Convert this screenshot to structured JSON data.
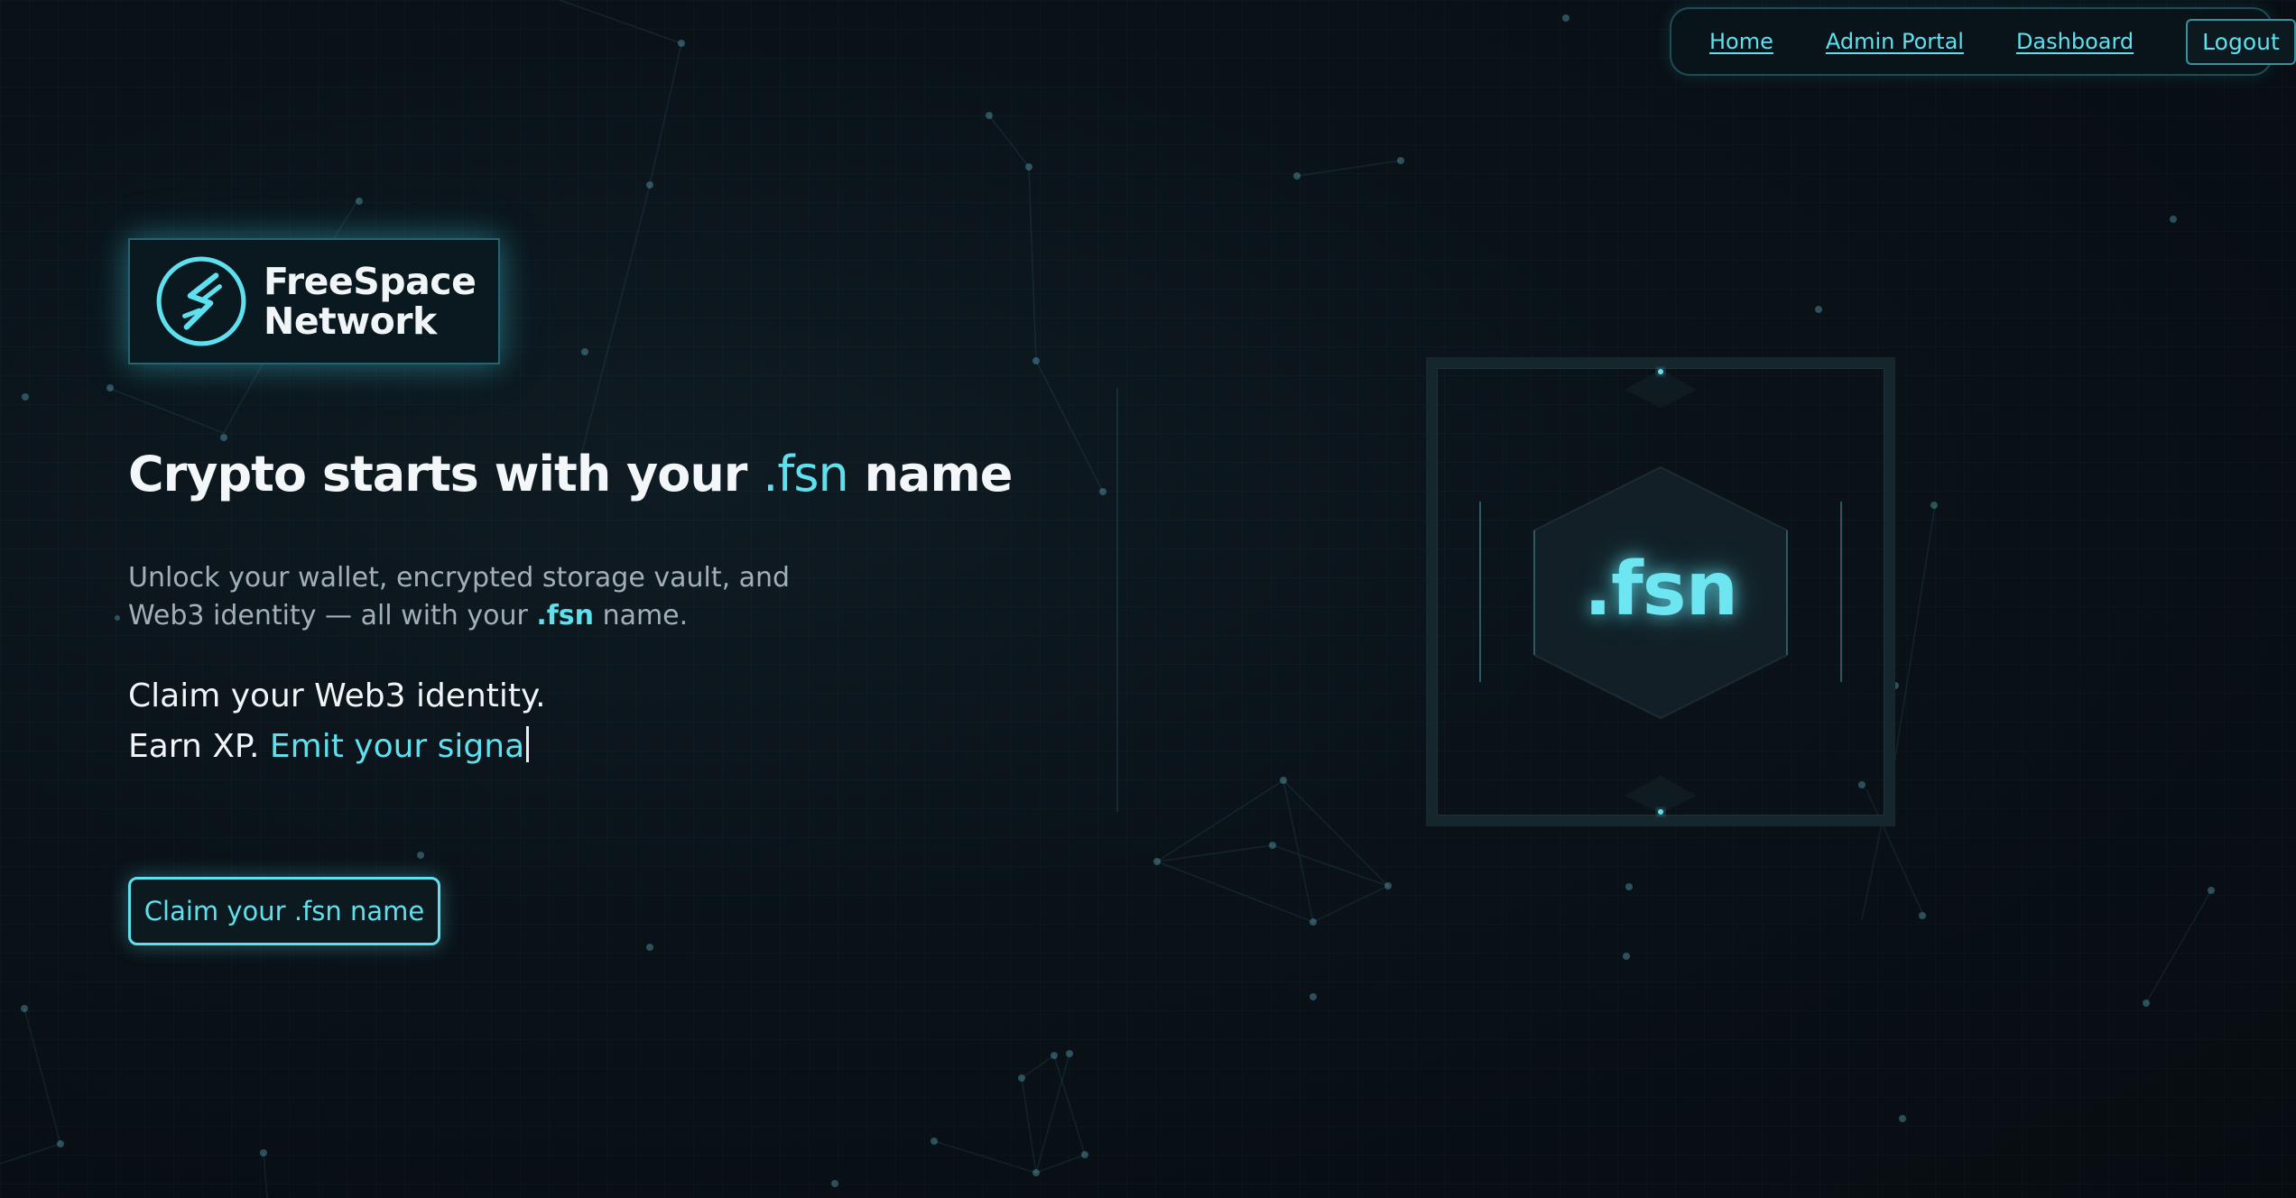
{
  "nav": {
    "home": "Home",
    "admin_portal": "Admin Portal",
    "dashboard": "Dashboard",
    "logout": "Logout"
  },
  "logo": {
    "line1": "FreeSpace",
    "line2": "Network",
    "icon": "freespace-network-logo-icon"
  },
  "hero": {
    "title_prefix": "Crypto starts with your",
    "title_accent": ".fsn",
    "title_suffix": "name",
    "subtitle_part1": "Unlock your wallet, encrypted storage vault, and Web3 identity — all with your",
    "subtitle_accent": ".fsn",
    "subtitle_part2": "name.",
    "line1": "Claim your Web3 identity.",
    "line2_prefix": "Earn XP.",
    "line2_typing": "Emit your signa",
    "cta": "Claim your .fsn name"
  },
  "graphic": {
    "label": ".fsn"
  },
  "colors": {
    "accent": "#5fe0ee",
    "background": "#0a1218",
    "text": "#f2f5f7",
    "muted": "#a3aeb6"
  }
}
